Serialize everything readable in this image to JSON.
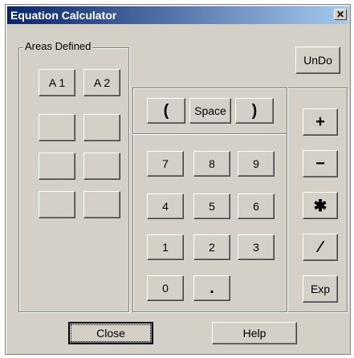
{
  "window": {
    "title": "Equation Calculator",
    "close_glyph": "✕"
  },
  "areas": {
    "legend": "Areas Defined",
    "a1": "A 1",
    "a2": "A 2"
  },
  "undo": "UnDo",
  "paren": {
    "open": "(",
    "space": "Space",
    "close": ")"
  },
  "digits": {
    "d7": "7",
    "d8": "8",
    "d9": "9",
    "d4": "4",
    "d5": "5",
    "d6": "6",
    "d1": "1",
    "d2": "2",
    "d3": "3",
    "d0": "0",
    "dot": "."
  },
  "ops": {
    "plus": "+",
    "minus": "−",
    "times": "✱",
    "divide": "∕",
    "exp": "Exp"
  },
  "footer": {
    "close": "Close",
    "help": "Help"
  }
}
